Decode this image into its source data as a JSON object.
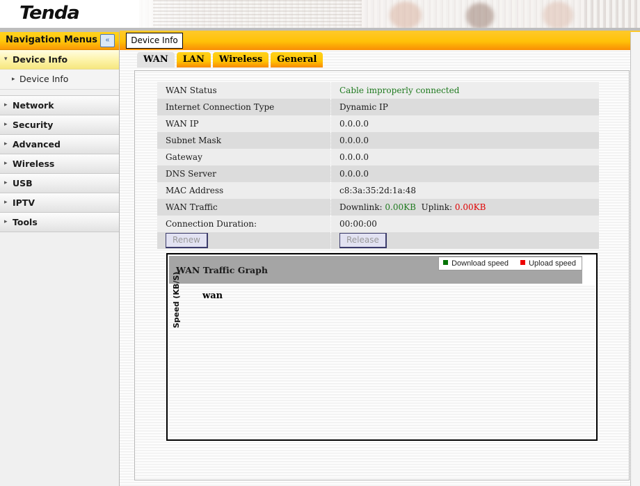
{
  "brand": {
    "logo_text": "Tenda"
  },
  "window_tab": {
    "label": "Device Info"
  },
  "sidebar": {
    "header_title": "Navigation Menus",
    "collapse_icon": "«",
    "active_group": {
      "label": "Device Info",
      "caret": "▾"
    },
    "active_sub": {
      "label": "Device Info",
      "caret": "▸"
    },
    "groups": [
      {
        "label": "Network",
        "caret": "▸"
      },
      {
        "label": "Security",
        "caret": "▸"
      },
      {
        "label": "Advanced",
        "caret": "▸"
      },
      {
        "label": "Wireless",
        "caret": "▸"
      },
      {
        "label": "USB",
        "caret": "▸"
      },
      {
        "label": "IPTV",
        "caret": "▸"
      },
      {
        "label": "Tools",
        "caret": "▸"
      }
    ]
  },
  "subtabs": [
    {
      "label": "WAN",
      "active": true
    },
    {
      "label": "LAN",
      "active": false
    },
    {
      "label": "Wireless",
      "active": false
    },
    {
      "label": "General",
      "active": false
    }
  ],
  "info_rows": [
    {
      "key": "WAN Status",
      "value": "Cable improperly connected",
      "style": "green"
    },
    {
      "key": "Internet Connection Type",
      "value": "Dynamic IP",
      "style": ""
    },
    {
      "key": "WAN IP",
      "value": "0.0.0.0",
      "style": ""
    },
    {
      "key": "Subnet Mask",
      "value": "0.0.0.0",
      "style": ""
    },
    {
      "key": "Gateway",
      "value": "0.0.0.0",
      "style": ""
    },
    {
      "key": "DNS Server",
      "value": "0.0.0.0",
      "style": ""
    },
    {
      "key": "MAC Address",
      "value": "c8:3a:35:2d:1a:48",
      "style": ""
    },
    {
      "key": "WAN Traffic",
      "value": "",
      "style": ""
    },
    {
      "key": "Connection Duration:",
      "value": "00:00:00",
      "style": ""
    }
  ],
  "wan_traffic": {
    "downlink_label": "Downlink:",
    "downlink_value": "0.00KB",
    "uplink_label": "Uplink:",
    "uplink_value": "0.00KB"
  },
  "buttons": {
    "renew": "Renew",
    "release": "Release"
  },
  "graph": {
    "title": "WAN Traffic Graph",
    "legend": [
      {
        "label": "Download speed",
        "color": "#067306"
      },
      {
        "label": "Upload speed",
        "color": "#ee0000"
      }
    ],
    "plot_title": "wan",
    "yaxis_label": "Speed (KB/S)"
  },
  "chart_data": {
    "type": "line",
    "title": "wan",
    "xlabel": "",
    "ylabel": "Speed (KB/S)",
    "x": [],
    "series": [
      {
        "name": "Download speed",
        "color": "#067306",
        "values": []
      },
      {
        "name": "Upload speed",
        "color": "#ee0000",
        "values": []
      }
    ],
    "grid": false,
    "legend_position": "top-right",
    "note": "empty plot - no data plotted"
  },
  "colors": {
    "accent_orange": "#f98d05",
    "accent_gold": "#ffc90c",
    "status_ok": "#1f7a1f",
    "status_alert": "#e00000"
  }
}
